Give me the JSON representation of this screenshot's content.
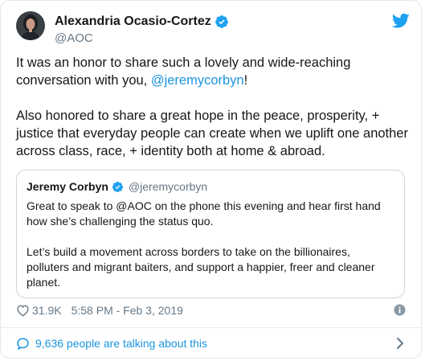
{
  "author": {
    "name": "Alexandria Ocasio-Cortez",
    "handle": "@AOC",
    "verified": true
  },
  "tweet": {
    "text_before_mention": "It was an honor to share such a lovely and wide-reaching conversation with you, ",
    "mention": "@jeremycorbyn",
    "text_after_mention": "!",
    "paragraph2": "Also honored to share a great hope in the peace, prosperity, + justice that everyday people can create when we uplift one another across class, race, + identity both at home & abroad."
  },
  "quoted": {
    "name": "Jeremy Corbyn",
    "handle": "@jeremycorbyn",
    "verified": true,
    "paragraph1": "Great to speak to @AOC on the phone this evening and hear first hand how she’s challenging the status quo.",
    "paragraph2": "Let’s build a movement across borders to take on the billionaires, polluters and migrant baiters, and support a happier, freer and cleaner planet."
  },
  "meta": {
    "likes": "31.9K",
    "timestamp": "5:58 PM - Feb 3, 2019"
  },
  "footer": {
    "talking_label": "9,636 people are talking about this"
  },
  "colors": {
    "link": "#1b95e0",
    "verified": "#1da1f2",
    "secondary_text": "#657786"
  },
  "icons": {
    "verified": "verified-badge-icon",
    "brand": "twitter-bird-icon",
    "like": "heart-icon",
    "info": "info-icon",
    "talk": "speech-bubble-icon",
    "more": "chevron-right-icon"
  }
}
